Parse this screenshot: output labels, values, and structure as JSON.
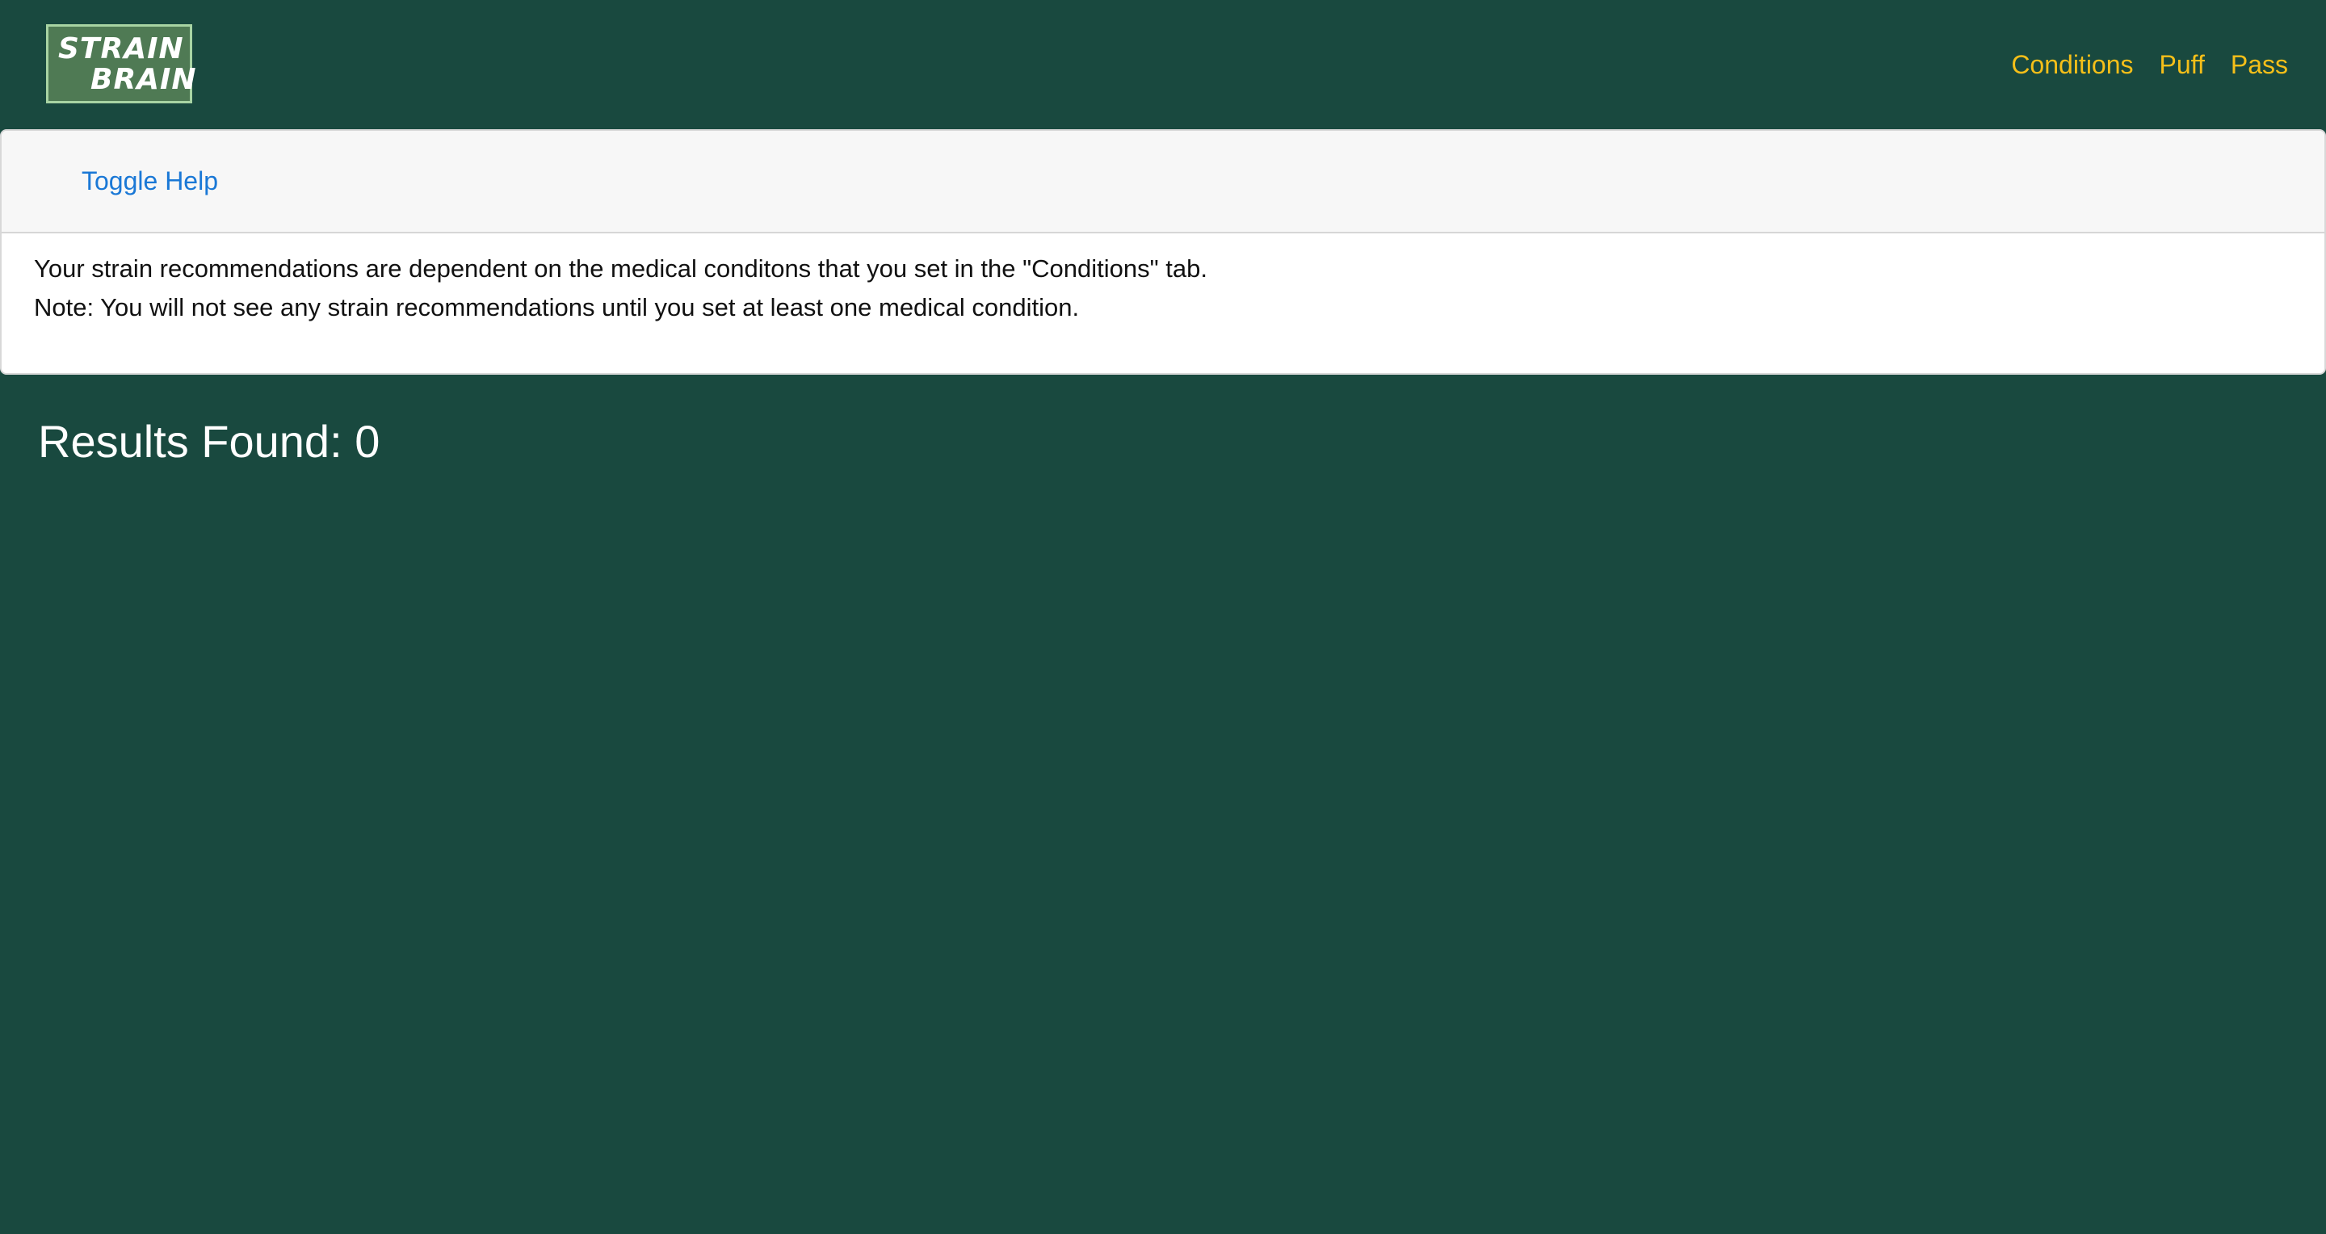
{
  "navbar": {
    "logo": {
      "line1": "STRAIN",
      "line2": "BRAIN"
    },
    "links": [
      {
        "label": "Conditions"
      },
      {
        "label": "Puff"
      },
      {
        "label": "Pass"
      }
    ],
    "link_color": "#f5bf19"
  },
  "help": {
    "toggle_label": "Toggle Help",
    "lines": [
      "Your strain recommendations are dependent on the medical conditons that you set in the \"Conditions\" tab.",
      "Note: You will not see any strain recommendations until you set at least one medical condition."
    ]
  },
  "results": {
    "heading": "Results Found: 0",
    "items": []
  },
  "colors": {
    "background": "#19493f",
    "logo_bg": "#4f7a54",
    "toggle_link": "#1a78d6"
  }
}
